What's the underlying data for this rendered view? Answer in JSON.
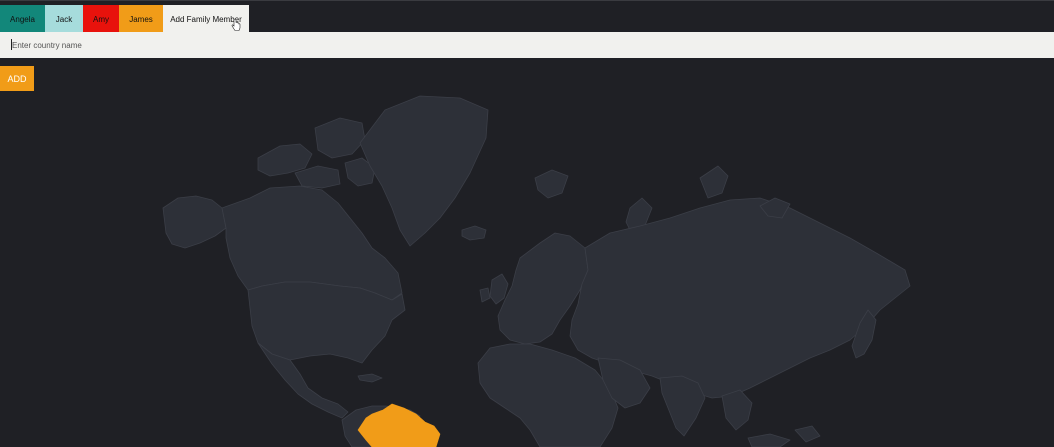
{
  "tabs": [
    {
      "label": "Angela",
      "color": "#12877a"
    },
    {
      "label": "Jack",
      "color": "#a6dcdc"
    },
    {
      "label": "Amy",
      "color": "#e8120c"
    },
    {
      "label": "James",
      "color": "#f19c18"
    }
  ],
  "add_tab": {
    "label": "Add Family Member",
    "color": "#f1f1ee"
  },
  "country_input": {
    "placeholder": "Enter country name",
    "value": ""
  },
  "add_button": {
    "label": "ADD",
    "color": "#f19c18"
  },
  "map": {
    "background": "#1f2025",
    "land_color": "#2d3038",
    "border_color": "#3b3e47",
    "highlighted_countries": [
      {
        "name": "Brazil",
        "color": "#f19c18"
      }
    ]
  }
}
